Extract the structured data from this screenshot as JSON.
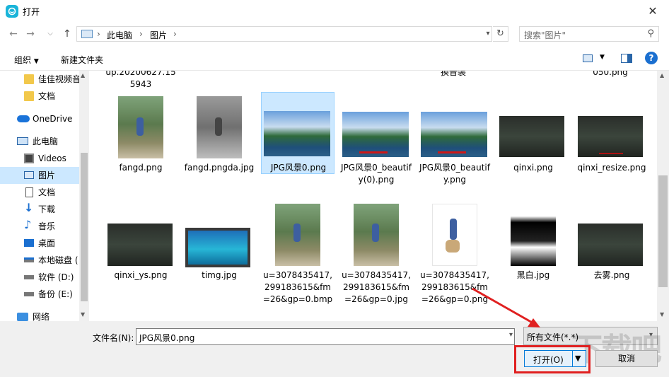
{
  "window": {
    "title": "打开",
    "close_glyph": "✕"
  },
  "nav": {
    "back": "←",
    "forward": "→",
    "recent": "⌵",
    "up": "↑",
    "breadcrumb": [
      "此电脑",
      "图片"
    ],
    "breadcrumb_sep": "›",
    "search_placeholder": "搜索\"图片\""
  },
  "toolbar": {
    "organize": "组织",
    "new_folder": "新建文件夹"
  },
  "sidebar": {
    "items": [
      {
        "label": "佳佳视频音",
        "icon": "folder-icon"
      },
      {
        "label": "文档",
        "icon": "folder-icon"
      },
      {
        "label": "OneDrive",
        "icon": "cloud-icon"
      },
      {
        "label": "此电脑",
        "icon": "computer-icon"
      },
      {
        "label": "Videos",
        "icon": "video-icon"
      },
      {
        "label": "图片",
        "icon": "picture-icon"
      },
      {
        "label": "文档",
        "icon": "document-icon"
      },
      {
        "label": "下载",
        "icon": "download-icon"
      },
      {
        "label": "音乐",
        "icon": "music-icon"
      },
      {
        "label": "桌面",
        "icon": "desktop-icon"
      },
      {
        "label": "本地磁盘 (",
        "icon": "drive-icon"
      },
      {
        "label": "软件 (D:)",
        "icon": "drive-icon"
      },
      {
        "label": "备份 (E:)",
        "icon": "drive-icon"
      },
      {
        "label": "网络",
        "icon": "network-icon"
      }
    ]
  },
  "files": {
    "partial_top": [
      "up.20200627.15 5943",
      "换音装",
      "050.png"
    ],
    "row1": [
      "fangd.png",
      "fangd.pngda.jpg",
      "JPG风景0.png",
      "JPG风景0_beautify(0).png",
      "JPG风景0_beautify.png",
      "qinxi.png",
      "qinxi_resize.png"
    ],
    "row2": [
      "qinxi_ys.png",
      "timg.jpg",
      "u=3078435417,299183615&fm=26&gp=0.bmp",
      "u=3078435417,299183615&fm=26&gp=0.jpg",
      "u=3078435417,299183615&fm=26&gp=0.png",
      "黑白.jpg",
      "去雾.png"
    ]
  },
  "footer": {
    "filename_label": "文件名(N):",
    "filename_value": "JPG风景0.png",
    "filter_value": "所有文件(*.*)",
    "open_button": "打开(O)",
    "cancel_button": "取消",
    "watermark": "下载吧"
  },
  "colors": {
    "accent": "#0078d7",
    "selection": "#cce8ff",
    "annotation": "#e02020"
  }
}
